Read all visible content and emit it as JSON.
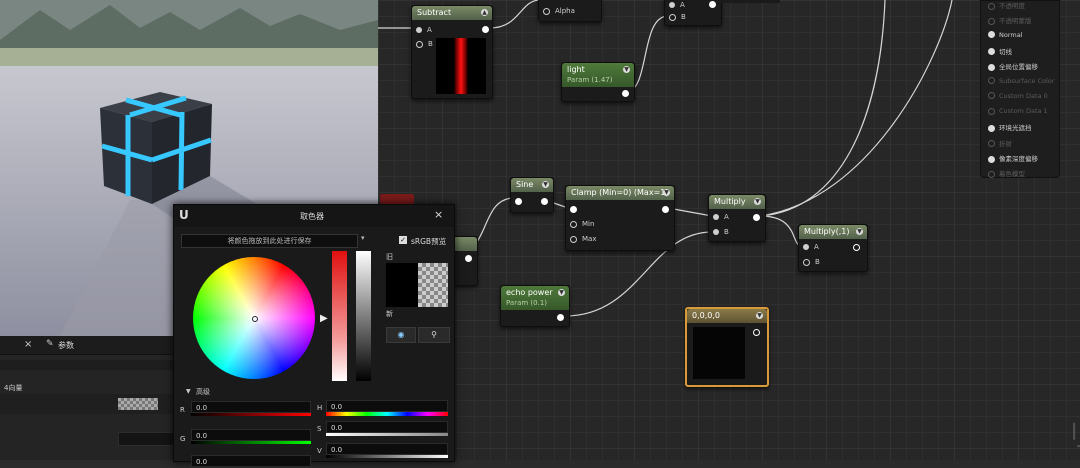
{
  "graph": {
    "subtract": {
      "title": "Subtract",
      "pin_a": "A",
      "pin_b": "B"
    },
    "top_alpha": {
      "label": "Alpha"
    },
    "top_ab": {
      "pin_a": "A",
      "pin_b": "B"
    },
    "light_param": {
      "title": "light",
      "subtitle": "Param (1.47)"
    },
    "sine": {
      "title": "Sine"
    },
    "clamp": {
      "title": "Clamp (Min=0) (Max=1)",
      "pin_min": "Min",
      "pin_max": "Max"
    },
    "multiply": {
      "title": "Multiply",
      "pin_a": "A",
      "pin_b": "B"
    },
    "multiply2": {
      "title": "Multiply(,1)",
      "pin_a": "A",
      "pin_b": "B"
    },
    "echo_param": {
      "title": "echo power",
      "subtitle": "Param (0.1)"
    },
    "const_color": {
      "title": "0,0,0,0"
    }
  },
  "output_panel": {
    "items": [
      {
        "label": "不透明度",
        "active": false
      },
      {
        "label": "不透明蒙版",
        "active": false
      },
      {
        "label": "Normal",
        "active": true
      },
      {
        "label": "切线",
        "active": true
      },
      {
        "label": "全局位置偏移",
        "active": true
      },
      {
        "label": "Subsurface Color",
        "active": false
      },
      {
        "label": "Custom Data 0",
        "active": false
      },
      {
        "label": "Custom Data 1",
        "active": false
      },
      {
        "label": "环境光遮挡",
        "active": true
      },
      {
        "label": "折射",
        "active": false
      },
      {
        "label": "像素深度偏移",
        "active": true
      },
      {
        "label": "着色模型",
        "active": false
      }
    ]
  },
  "details": {
    "close_glyph": "×",
    "params_tab": "参数",
    "vector_label": "4向量"
  },
  "color_picker": {
    "title": "取色器",
    "close_glyph": "×",
    "drag_hint": "将颜色拖放到此处进行保存",
    "srgb_label": "sRGB预览",
    "old_label": "旧",
    "new_label": "新",
    "advanced_label": "高级",
    "channels": [
      {
        "key": "R",
        "value": "0.0"
      },
      {
        "key": "G",
        "value": "0.0"
      },
      {
        "key": "B",
        "value": "0.0"
      }
    ],
    "hsv": [
      {
        "key": "H",
        "value": "0.0"
      },
      {
        "key": "S",
        "value": "0.0"
      },
      {
        "key": "V",
        "value": "0.0"
      }
    ]
  },
  "colors": {
    "node_header": "#5d6d52",
    "param_header": "#3f6a30",
    "selected_outline": "#d89a38",
    "cube_glow": "#36c8ff"
  }
}
